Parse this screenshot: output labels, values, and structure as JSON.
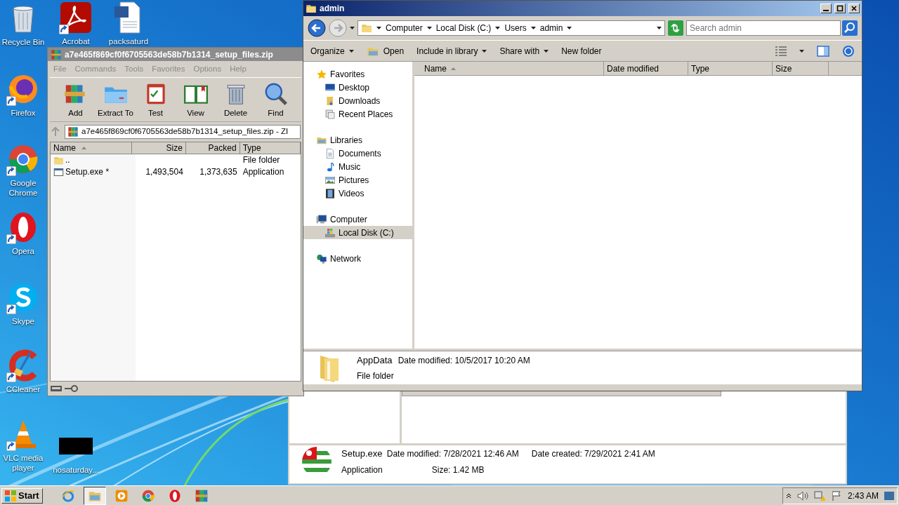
{
  "desktop_icons": [
    {
      "label": "Recycle Bin",
      "kind": "recycle",
      "shortcut": false
    },
    {
      "label": "Acrobat",
      "kind": "acrobat",
      "shortcut": true
    },
    {
      "label": "packsaturd",
      "kind": "word",
      "shortcut": false
    },
    {
      "label": "Firefox",
      "kind": "firefox",
      "shortcut": true
    },
    {
      "label": "Google Chrome",
      "kind": "chrome",
      "shortcut": true
    },
    {
      "label": "Opera",
      "kind": "opera",
      "shortcut": true
    },
    {
      "label": "Skype",
      "kind": "skype",
      "shortcut": true
    },
    {
      "label": "CCleaner",
      "kind": "ccleaner",
      "shortcut": true
    },
    {
      "label": "VLC media player",
      "kind": "vlc",
      "shortcut": true
    },
    {
      "label": "nosaturday...",
      "kind": "blank",
      "shortcut": false
    }
  ],
  "winrar": {
    "title": "a7e465f869cf0f6705563de58b7b1314_setup_files.zip",
    "menu": [
      "File",
      "Commands",
      "Tools",
      "Favorites",
      "Options",
      "Help"
    ],
    "toolbar": [
      {
        "label": "Add",
        "kind": "add"
      },
      {
        "label": "Extract To",
        "kind": "extract"
      },
      {
        "label": "Test",
        "kind": "test"
      },
      {
        "label": "View",
        "kind": "view"
      },
      {
        "label": "Delete",
        "kind": "delete"
      },
      {
        "label": "Find",
        "kind": "find"
      }
    ],
    "address": "a7e465f869cf0f6705563de58b7b1314_setup_files.zip - ZI",
    "columns": [
      {
        "label": "Name",
        "sorted": true
      },
      {
        "label": "Size",
        "sorted": false
      },
      {
        "label": "Packed",
        "sorted": false
      },
      {
        "label": "Type",
        "sorted": false
      }
    ],
    "rows": [
      {
        "kind": "folder",
        "name": "..",
        "type": "File folder"
      },
      {
        "kind": "exe",
        "name": "Setup.exe *",
        "size": "1,493,504",
        "packed": "1,373,635",
        "type": "Application"
      }
    ]
  },
  "explorer": {
    "title": "admin",
    "breadcrumbs": [
      "Computer",
      "Local Disk (C:)",
      "Users",
      "admin"
    ],
    "search": {
      "placeholder": "Search admin"
    },
    "toolbar": [
      {
        "label": "Organize",
        "kind": "menu"
      },
      {
        "label": "Open",
        "kind": "open"
      },
      {
        "label": "Include in library",
        "kind": "menu"
      },
      {
        "label": "Share with",
        "kind": "menu"
      },
      {
        "label": "New folder",
        "kind": "plain"
      }
    ],
    "nav": [
      {
        "label": "Favorites",
        "kind": "star",
        "selected": false,
        "children": [
          {
            "label": "Desktop",
            "kind": "desktop",
            "selected": false
          },
          {
            "label": "Downloads",
            "kind": "downloads",
            "selected": false
          },
          {
            "label": "Recent Places",
            "kind": "recent",
            "selected": false
          }
        ]
      },
      {
        "label": "Libraries",
        "kind": "library",
        "selected": false,
        "children": [
          {
            "label": "Documents",
            "kind": "documents",
            "selected": false
          },
          {
            "label": "Music",
            "kind": "music",
            "selected": false
          },
          {
            "label": "Pictures",
            "kind": "pictures",
            "selected": false
          },
          {
            "label": "Videos",
            "kind": "videos",
            "selected": false
          }
        ]
      },
      {
        "label": "Computer",
        "kind": "computer",
        "selected": false,
        "children": [
          {
            "label": "Local Disk (C:)",
            "kind": "disk",
            "selected": true
          }
        ]
      },
      {
        "label": "Network",
        "kind": "network",
        "selected": false
      }
    ],
    "columns": [
      {
        "label": "Name",
        "sorted": true
      },
      {
        "label": "Date modified",
        "sorted": false
      },
      {
        "label": "Type",
        "sorted": false
      },
      {
        "label": "Size",
        "sorted": false
      }
    ],
    "details": {
      "name": "AppData",
      "modified": "Date modified: 10/5/2017 10:20 AM",
      "type": "File folder"
    }
  },
  "background_window": {
    "details": {
      "name": "Setup.exe",
      "modified": "Date modified: 7/28/2021 12:46 AM",
      "created": "Date created: 7/29/2021 2:41 AM",
      "type": "Application",
      "size": "Size: 1.42 MB"
    }
  },
  "taskbar": {
    "start": "Start",
    "apps": [
      {
        "kind": "ie",
        "selected": false
      },
      {
        "kind": "explorer",
        "selected": true
      },
      {
        "kind": "media",
        "selected": false
      },
      {
        "kind": "chrome",
        "selected": false
      },
      {
        "kind": "opera",
        "selected": false
      },
      {
        "kind": "winrar",
        "selected": false
      }
    ],
    "clock": "2:43 AM"
  }
}
